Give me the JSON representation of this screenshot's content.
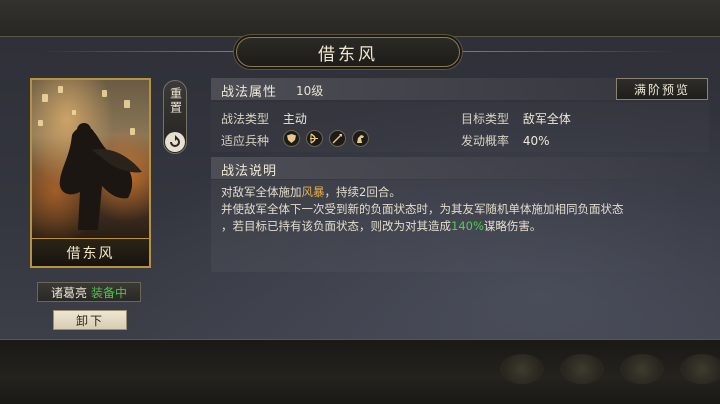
{
  "window": {
    "title": "借东风"
  },
  "card": {
    "name": "借东风"
  },
  "side": {
    "reset_label": "重置"
  },
  "general": {
    "name": "诸葛亮",
    "status": "装备中"
  },
  "unload_label": "卸下",
  "attributes": {
    "section_title": "战法属性",
    "level": "10级",
    "preview_label": "满阶预览",
    "type_label": "战法类型",
    "type_value": "主动",
    "target_label": "目标类型",
    "target_value": "敌军全体",
    "troop_label": "适应兵种",
    "troops": [
      "shield-icon",
      "bow-icon",
      "spear-icon",
      "horse-icon"
    ],
    "rate_label": "发动概率",
    "rate_value": "40%"
  },
  "description": {
    "section_title": "战法说明",
    "line1_a": "对敌军全体施加",
    "line1_hl": "风暴",
    "line1_b": "，持续2回合。",
    "line2": "并使敌军全体下一次受到新的负面状态时，为其友军随机单体施加相同负面状态",
    "line3_a": "，若目标已持有该负面状态，则改为对其造成",
    "line3_hl": "140%",
    "line3_b": "谋略伤害。"
  },
  "colors": {
    "gold": "#b8923e",
    "highlight": "#e6b04a",
    "green": "#4fc24f"
  }
}
